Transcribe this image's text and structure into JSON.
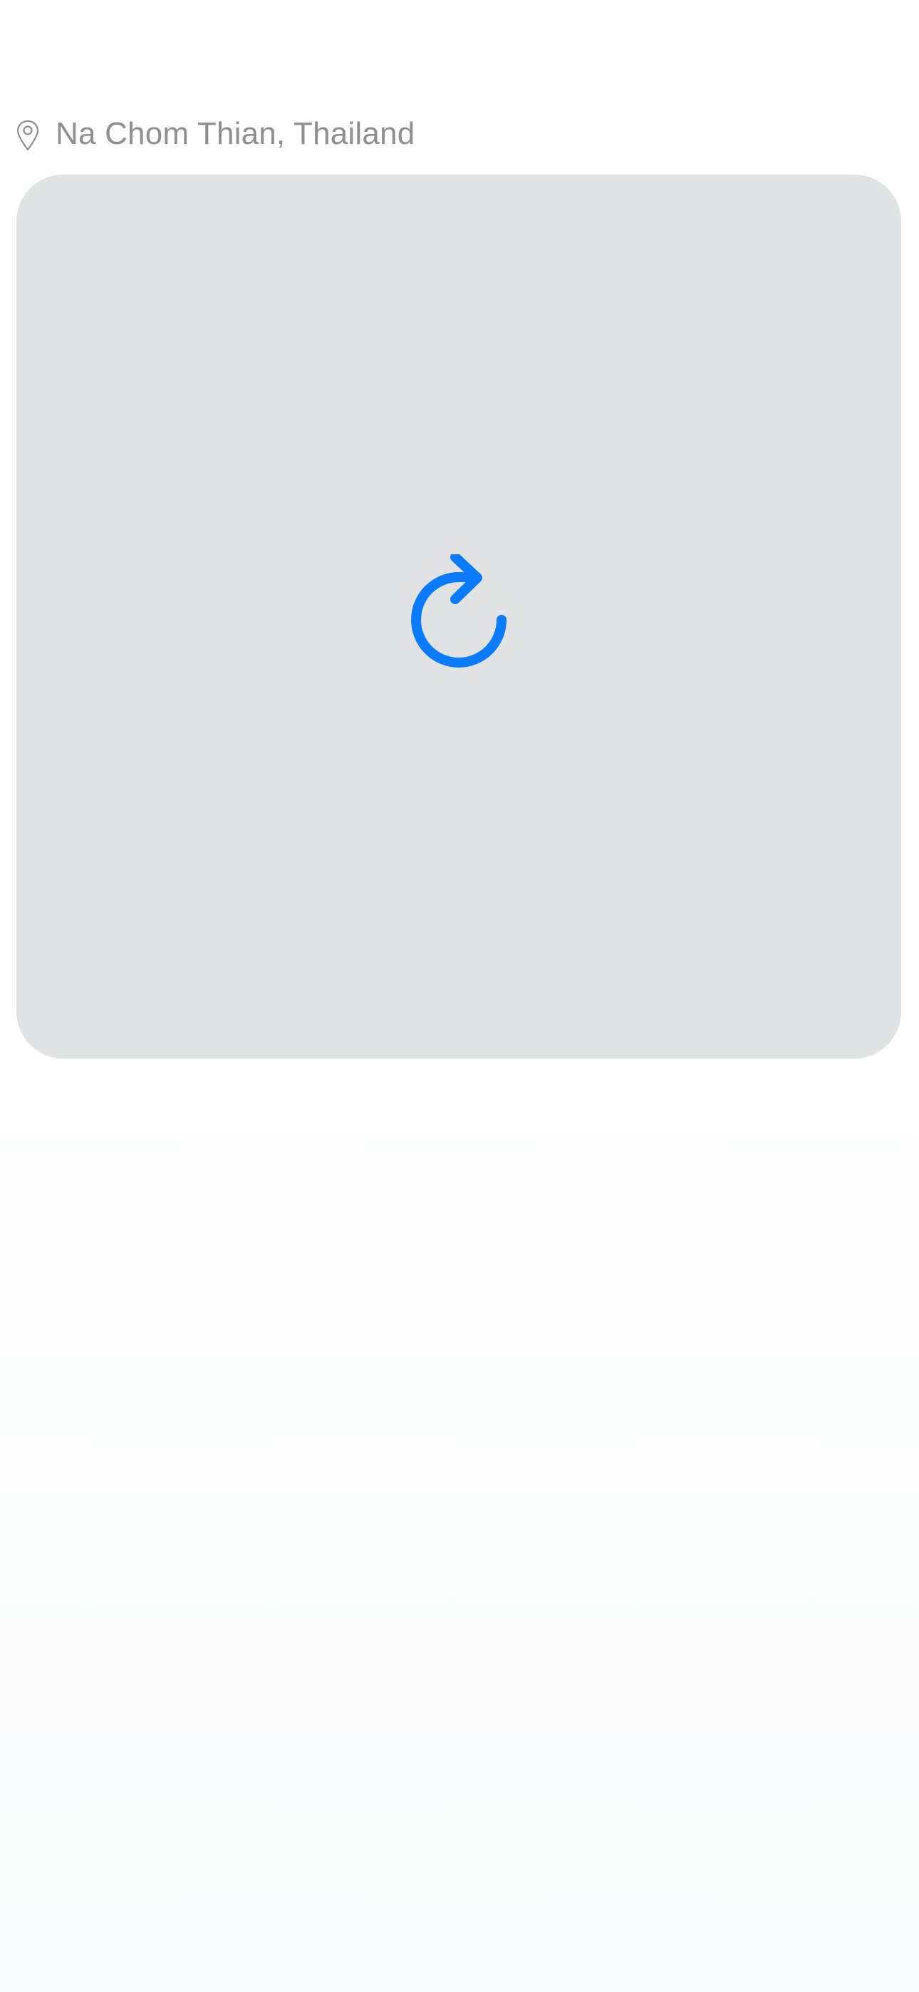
{
  "location": {
    "icon": "map-pin-icon",
    "text": "Na Chom Thian, Thailand"
  },
  "photo_card": {
    "state": "loading",
    "reload_icon": "reload-icon",
    "colors": {
      "card_background": "#e1e2e3",
      "accent": "#0a7aff",
      "secondary_text": "#8e8e93"
    }
  }
}
